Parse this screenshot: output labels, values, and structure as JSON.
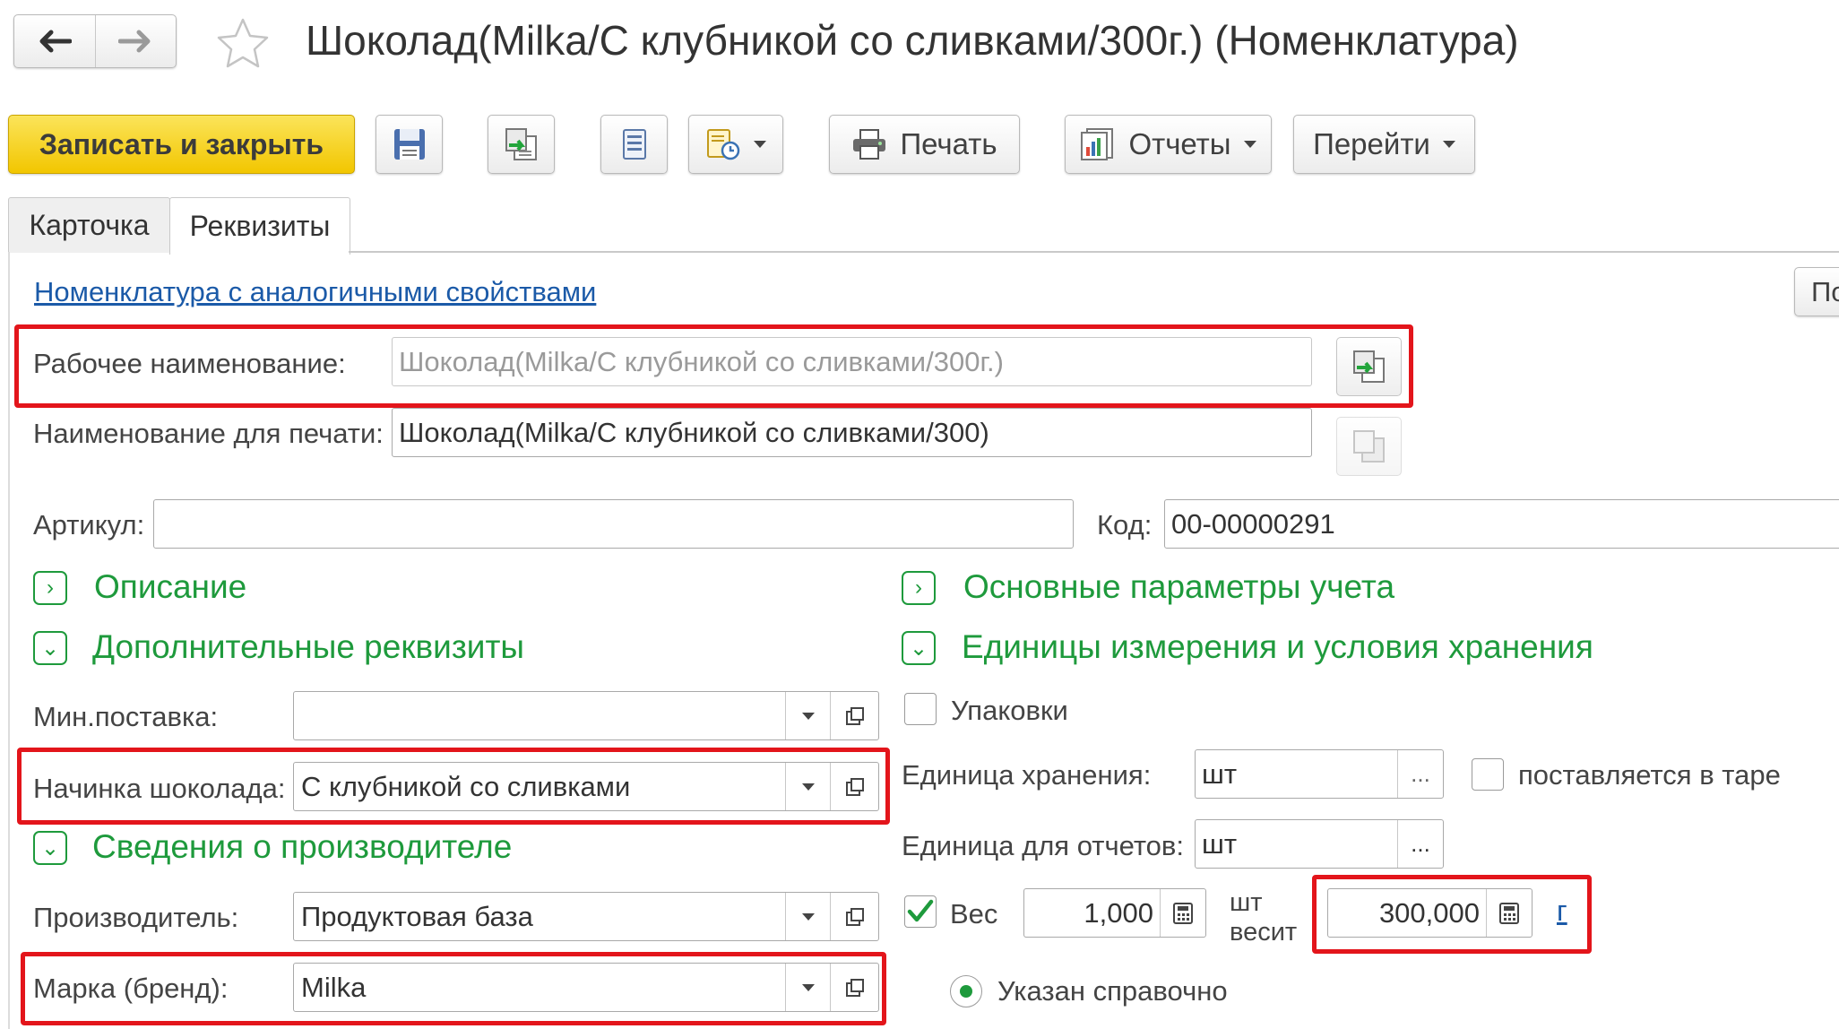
{
  "window": {
    "title": "Шоколад(Milka/С клубникой со сливками/300г.) (Номенклатура)"
  },
  "toolbar": {
    "save_close_label": "Записать и закрыть",
    "print_label": "Печать",
    "reports_label": "Отчеты",
    "goto_label": "Перейти"
  },
  "tabs": [
    {
      "label": "Карточка",
      "active": false
    },
    {
      "label": "Реквизиты",
      "active": true
    }
  ],
  "form": {
    "similar_link": "Номенклатура с аналогичными свойствами",
    "side_button_partial": "По",
    "working_name": {
      "label": "Рабочее наименование:",
      "value": "Шоколад(Milka/С клубникой со сливками/300г.)"
    },
    "print_name": {
      "label": "Наименование для печати:",
      "value": "Шоколад(Milka/С клубникой со сливками/300)"
    },
    "article": {
      "label": "Артикул:",
      "value": ""
    },
    "code": {
      "label": "Код:",
      "value": "00-00000291"
    }
  },
  "sections": {
    "description": "Описание",
    "additional": "Дополнительные реквизиты",
    "manufacturer_info": "Сведения о производителе",
    "accounting": "Основные параметры учета",
    "units": "Единицы измерения и условия хранения"
  },
  "additional": {
    "min_supply": {
      "label": "Мин.поставка:",
      "value": ""
    },
    "filling": {
      "label": "Начинка шоколада:",
      "value": "С клубникой со сливками"
    }
  },
  "manufacturer": {
    "producer": {
      "label": "Производитель:",
      "value": "Продуктовая база"
    },
    "brand": {
      "label": "Марка (бренд):",
      "value": "Milka"
    }
  },
  "units": {
    "packages_label": "Упаковки",
    "packages_checked": false,
    "storage_unit": {
      "label": "Единица хранения:",
      "value": "шт"
    },
    "tare_label": "поставляется в таре",
    "tare_checked": false,
    "report_unit": {
      "label": "Единица для отчетов:",
      "value": "шт"
    },
    "weight_label": "Вес",
    "weight_checked": true,
    "weight_qty": "1,000",
    "weight_unit_line1": "шт",
    "weight_unit_line2": "весит",
    "weight_value": "300,000",
    "weight_unit_link": "г",
    "reference_label": "Указан справочно",
    "ellipsis": "..."
  },
  "colors": {
    "highlight": "#e3151b",
    "section_green": "#1e9a3c",
    "primary_yellow": "#f2c600",
    "link_blue": "#1b5aa8"
  }
}
